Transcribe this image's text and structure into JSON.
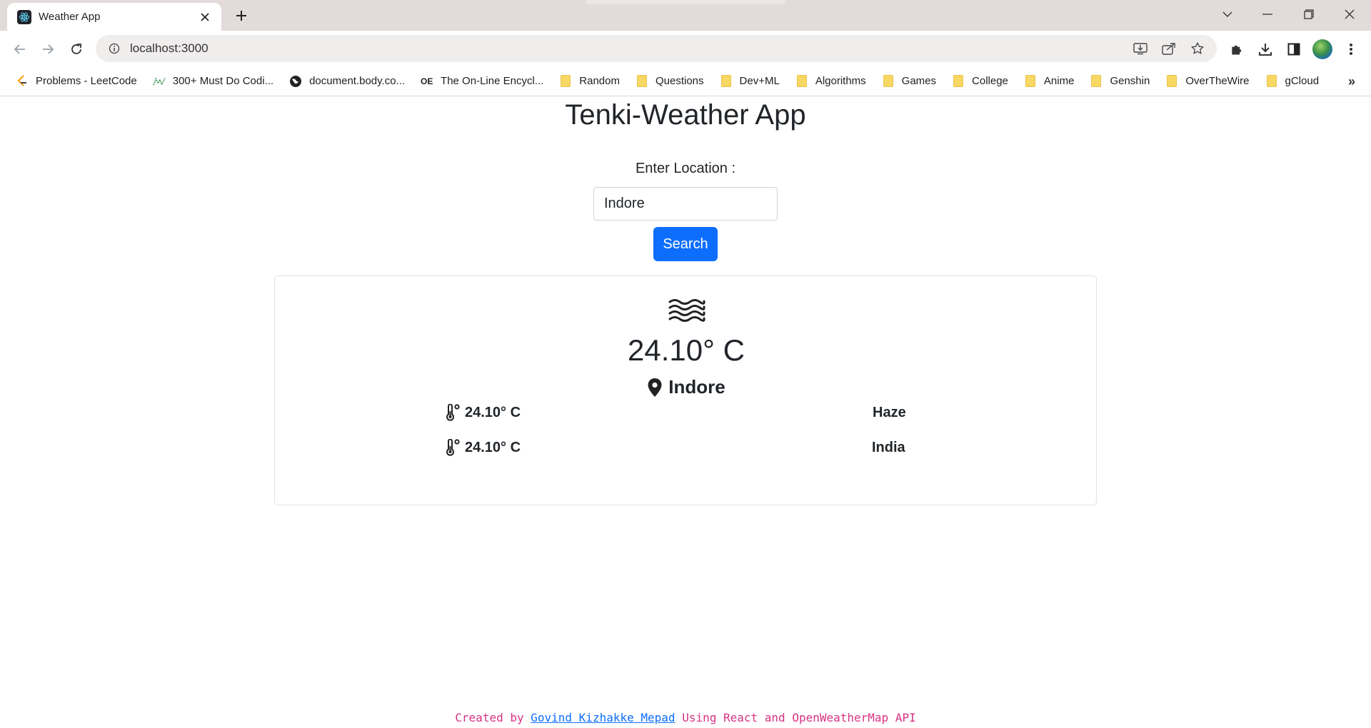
{
  "browser": {
    "tab_title": "Weather App",
    "url": "localhost:3000",
    "bookmarks": [
      {
        "label": "Problems - LeetCode",
        "icon": "leetcode-icon"
      },
      {
        "label": "300+ Must Do Codi...",
        "icon": "geeks-icon"
      },
      {
        "label": "document.body.co...",
        "icon": "globe-icon"
      },
      {
        "label": "The On-Line Encycl...",
        "icon": "oeis-icon"
      },
      {
        "label": "Random",
        "icon": "folder-icon"
      },
      {
        "label": "Questions",
        "icon": "folder-icon"
      },
      {
        "label": "Dev+ML",
        "icon": "folder-icon"
      },
      {
        "label": "Algorithms",
        "icon": "folder-icon"
      },
      {
        "label": "Games",
        "icon": "folder-icon"
      },
      {
        "label": "College",
        "icon": "folder-icon"
      },
      {
        "label": "Anime",
        "icon": "folder-icon"
      },
      {
        "label": "Genshin",
        "icon": "folder-icon"
      },
      {
        "label": "OverTheWire",
        "icon": "folder-icon"
      },
      {
        "label": "gCloud",
        "icon": "folder-icon"
      }
    ],
    "more_bookmarks": "»"
  },
  "app": {
    "title": "Tenki-Weather App",
    "location_label": "Enter Location :",
    "location_value": "Indore",
    "search_label": "Search"
  },
  "weather": {
    "condition_icon": "haze-icon",
    "temperature": "24.10° C",
    "city": "Indore",
    "stats": {
      "temp_1": "24.10° C",
      "temp_2": "24.10° C",
      "condition": "Haze",
      "country": "India"
    }
  },
  "footer": {
    "prefix": "Created by",
    "author": "Govind Kizhakke Mepad",
    "suffix": "Using React and OpenWeatherMap API"
  }
}
